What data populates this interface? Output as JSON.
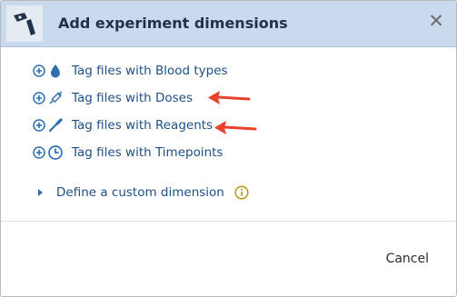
{
  "dialog": {
    "title": "Add experiment dimensions",
    "header_icon": "tag-flask-icon",
    "close_icon": "close-icon",
    "close_glyph": "✕"
  },
  "items": [
    {
      "label": "Tag files with Blood types",
      "icon": "blood-drop-icon"
    },
    {
      "label": "Tag files with Doses",
      "icon": "syringe-icon"
    },
    {
      "label": "Tag files with Reagents",
      "icon": "pipette-icon"
    },
    {
      "label": "Tag files with Timepoints",
      "icon": "clock-icon"
    }
  ],
  "custom_dimension": {
    "label": "Define a custom dimension",
    "expand_icon": "caret-right-icon",
    "info_icon": "info-icon"
  },
  "footer": {
    "cancel_label": "Cancel"
  },
  "colors": {
    "header_bg": "#c9daee",
    "link_blue": "#1f4f85",
    "icon_blue": "#2f6fb0",
    "annotation_red": "#e8412c",
    "info_gold": "#b69a12"
  }
}
